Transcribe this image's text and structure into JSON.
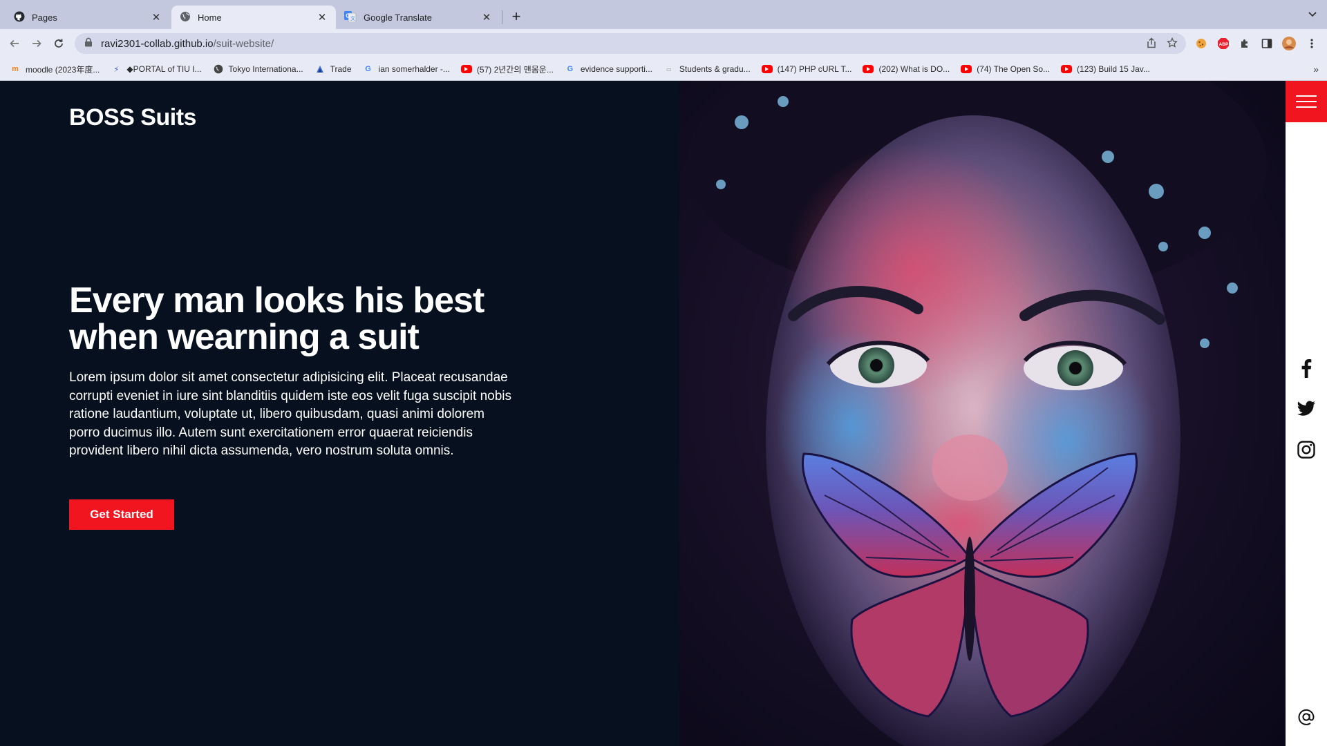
{
  "browser": {
    "tabs": [
      {
        "title": "Pages",
        "icon": "github-icon",
        "active": false
      },
      {
        "title": "Home",
        "icon": "globe-icon",
        "active": true
      },
      {
        "title": "Google Translate",
        "icon": "google-translate-icon",
        "active": false
      }
    ],
    "url_host": "ravi2301-collab.github.io",
    "url_path": "/suit-website/",
    "bookmarks": [
      {
        "label": "moodle (2023年度...",
        "icon": "moodle-icon"
      },
      {
        "label": "◆PORTAL of TIU I...",
        "icon": "portal-icon"
      },
      {
        "label": "Tokyo Internationa...",
        "icon": "globe-icon"
      },
      {
        "label": "Trade",
        "icon": "trade-icon"
      },
      {
        "label": "ian somerhalder -...",
        "icon": "google-icon"
      },
      {
        "label": "(57) 2년간의 맨몸운...",
        "icon": "youtube-icon"
      },
      {
        "label": "evidence supporti...",
        "icon": "google-icon"
      },
      {
        "label": "Students & gradu...",
        "icon": "site-icon"
      },
      {
        "label": "(147) PHP cURL T...",
        "icon": "youtube-icon"
      },
      {
        "label": "(202) What is DO...",
        "icon": "youtube-icon"
      },
      {
        "label": "(74) The Open So...",
        "icon": "youtube-icon"
      },
      {
        "label": "(123) Build 15 Jav...",
        "icon": "youtube-icon"
      }
    ],
    "bookmarks_more": "»"
  },
  "site": {
    "brand": "BOSS Suits",
    "headline_line1": "Every man looks his best",
    "headline_line2": "when wearning a suit",
    "body": "Lorem ipsum dolor sit amet consectetur adipisicing elit. Placeat recusandae corrupti eveniet in iure sint blanditiis quidem iste eos velit fuga suscipit nobis ratione laudantium, voluptate ut, libero quibusdam, quasi animi dolorem porro ducimus illo. Autem sunt exercitationem error quaerat reiciendis provident libero nihil dicta assumenda, vero nostrum soluta omnis.",
    "cta_label": "Get Started",
    "social": [
      "facebook-icon",
      "twitter-icon",
      "instagram-icon"
    ],
    "contact_icon": "at-sign-icon"
  },
  "colors": {
    "page_bg": "#06101e",
    "accent": "#f0151f",
    "chrome_tabstrip": "#c3c8de",
    "chrome_toolbar": "#e8ebf6"
  }
}
